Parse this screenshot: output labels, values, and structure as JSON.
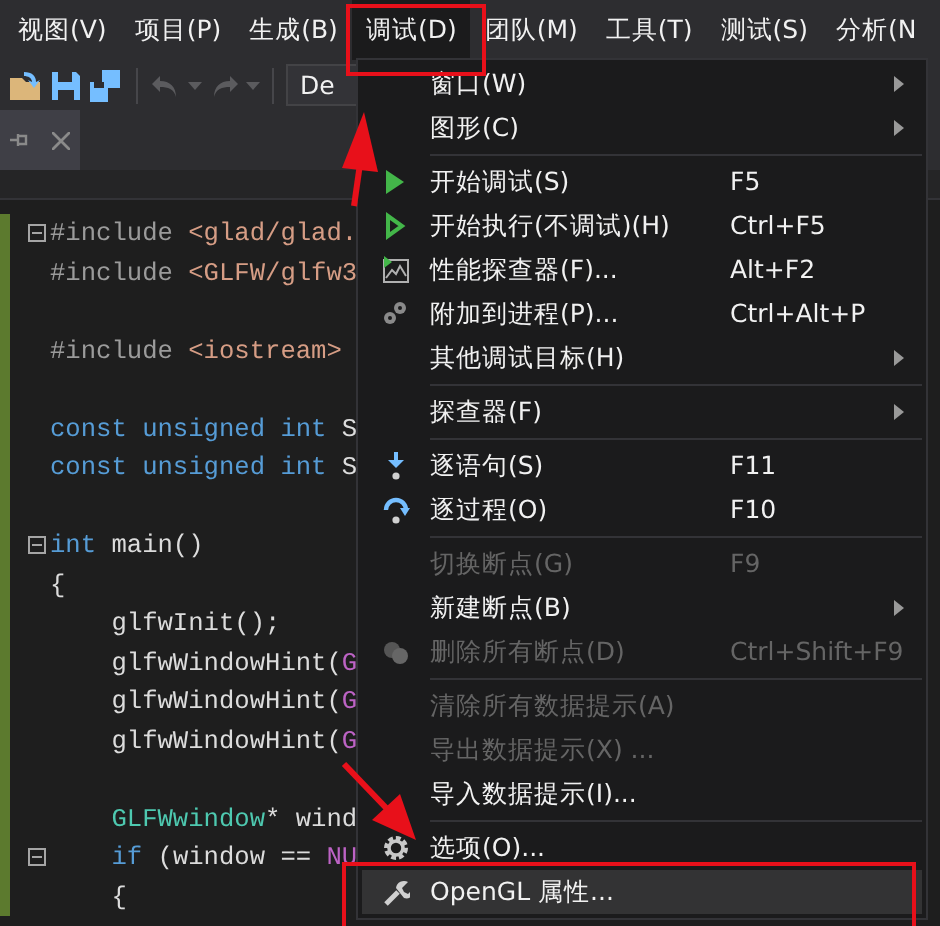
{
  "menu_bar": [
    {
      "label": "视图(V)",
      "selected": false
    },
    {
      "label": "项目(P)",
      "selected": false
    },
    {
      "label": "生成(B)",
      "selected": false
    },
    {
      "label": "调试(D)",
      "selected": true
    },
    {
      "label": "团队(M)",
      "selected": false
    },
    {
      "label": "工具(T)",
      "selected": false
    },
    {
      "label": "测试(S)",
      "selected": false
    },
    {
      "label": "分析(N",
      "selected": false
    }
  ],
  "toolbar": {
    "config_combo": "De"
  },
  "editor": {
    "lines": [
      {
        "toggle": {
          "expanded": true
        },
        "tokens": [
          {
            "text": "#include ",
            "kind": "pp"
          },
          {
            "text": "<glad/glad.",
            "kind": "str"
          }
        ]
      },
      {
        "tokens": [
          {
            "text": "#include ",
            "kind": "pp"
          },
          {
            "text": "<GLFW/glfw3",
            "kind": "str"
          }
        ]
      },
      {
        "kind": "blank"
      },
      {
        "tokens": [
          {
            "text": "#include ",
            "kind": "pp"
          },
          {
            "text": "<iostream>",
            "kind": "str"
          }
        ]
      },
      {
        "kind": "blank"
      },
      {
        "tokens": [
          {
            "text": "const unsigned int ",
            "kind": "kw"
          },
          {
            "text": "S",
            "kind": "plain"
          }
        ]
      },
      {
        "tokens": [
          {
            "text": "const unsigned int ",
            "kind": "kw"
          },
          {
            "text": "S",
            "kind": "plain"
          }
        ]
      },
      {
        "kind": "blank"
      },
      {
        "toggle": {
          "expanded": true
        },
        "tokens": [
          {
            "text": "int ",
            "kind": "kw"
          },
          {
            "text": "main()",
            "kind": "plain"
          }
        ]
      },
      {
        "tokens": [
          {
            "text": "{",
            "kind": "plain"
          }
        ]
      },
      {
        "tokens": [
          {
            "text": "    glfwInit();",
            "kind": "plain"
          }
        ]
      },
      {
        "tokens": [
          {
            "text": "    glfwWindowHint(",
            "kind": "plain"
          },
          {
            "text": "G",
            "kind": "macro"
          }
        ]
      },
      {
        "tokens": [
          {
            "text": "    glfwWindowHint(",
            "kind": "plain"
          },
          {
            "text": "G",
            "kind": "macro"
          }
        ]
      },
      {
        "tokens": [
          {
            "text": "    glfwWindowHint(",
            "kind": "plain"
          },
          {
            "text": "G",
            "kind": "macro"
          }
        ]
      },
      {
        "kind": "blank"
      },
      {
        "tokens": [
          {
            "text": "    GLFWwindow",
            "kind": "type"
          },
          {
            "text": "* wind",
            "kind": "plain"
          }
        ]
      },
      {
        "toggle": {
          "expanded": true
        },
        "tokens": [
          {
            "text": "    if ",
            "kind": "kw"
          },
          {
            "text": "(window == ",
            "kind": "plain"
          },
          {
            "text": "NU",
            "kind": "macro"
          }
        ]
      },
      {
        "tokens": [
          {
            "text": "    {",
            "kind": "plain"
          }
        ]
      }
    ]
  },
  "debug_menu": [
    {
      "kind": "item",
      "label": "窗口(W)",
      "submenu": true,
      "disabled": false,
      "selected": false
    },
    {
      "kind": "item",
      "label": "图形(C)",
      "submenu": true,
      "disabled": false,
      "selected": false
    },
    {
      "kind": "separator"
    },
    {
      "kind": "item",
      "label": "开始调试(S)",
      "shortcut": "F5",
      "disabled": false,
      "selected": false
    },
    {
      "kind": "item",
      "label": "开始执行(不调试)(H)",
      "shortcut": "Ctrl+F5",
      "disabled": false,
      "selected": false
    },
    {
      "kind": "item",
      "label": "性能探查器(F)...",
      "shortcut": "Alt+F2",
      "disabled": false,
      "selected": false
    },
    {
      "kind": "item",
      "label": "附加到进程(P)...",
      "shortcut": "Ctrl+Alt+P",
      "disabled": false,
      "selected": false
    },
    {
      "kind": "item",
      "label": "其他调试目标(H)",
      "submenu": true,
      "disabled": false,
      "selected": false
    },
    {
      "kind": "separator"
    },
    {
      "kind": "item",
      "label": "探查器(F)",
      "submenu": true,
      "disabled": false,
      "selected": false
    },
    {
      "kind": "separator"
    },
    {
      "kind": "item",
      "label": "逐语句(S)",
      "shortcut": "F11",
      "disabled": false,
      "selected": false
    },
    {
      "kind": "item",
      "label": "逐过程(O)",
      "shortcut": "F10",
      "disabled": false,
      "selected": false
    },
    {
      "kind": "separator"
    },
    {
      "kind": "item",
      "label": "切换断点(G)",
      "shortcut": "F9",
      "disabled": true,
      "selected": false
    },
    {
      "kind": "item",
      "label": "新建断点(B)",
      "submenu": true,
      "disabled": false,
      "selected": false
    },
    {
      "kind": "item",
      "label": "删除所有断点(D)",
      "shortcut": "Ctrl+Shift+F9",
      "disabled": true,
      "selected": false
    },
    {
      "kind": "separator"
    },
    {
      "kind": "item",
      "label": "清除所有数据提示(A)",
      "disabled": true,
      "selected": false
    },
    {
      "kind": "item",
      "label": "导出数据提示(X) ...",
      "disabled": true,
      "selected": false
    },
    {
      "kind": "item",
      "label": "导入数据提示(I)...",
      "disabled": false,
      "selected": false
    },
    {
      "kind": "separator"
    },
    {
      "kind": "item",
      "label": "选项(O)...",
      "disabled": false,
      "selected": false
    },
    {
      "kind": "item",
      "label": "OpenGL 属性...",
      "disabled": false,
      "selected": true
    }
  ]
}
